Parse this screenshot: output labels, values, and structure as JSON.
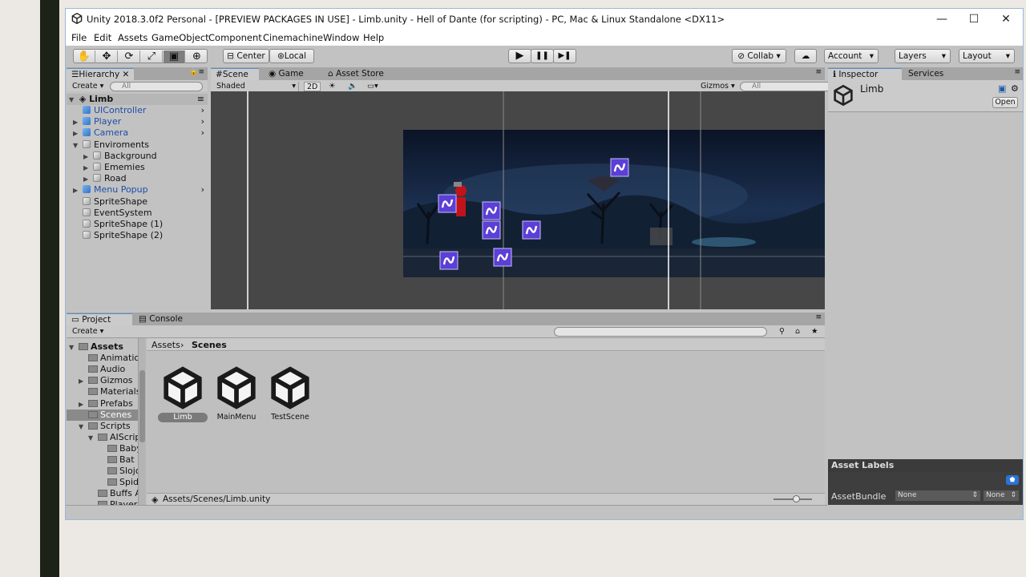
{
  "window": {
    "title": "Unity 2018.3.0f2 Personal - [PREVIEW PACKAGES IN USE] - Limb.unity - Hell of Dante (for scripting) - PC, Mac & Linux Standalone <DX11>",
    "minimize": "—",
    "maximize": "☐",
    "close": "✕"
  },
  "menu": [
    "File",
    "Edit",
    "Assets",
    "GameObject",
    "Component",
    "Cinemachine",
    "Window",
    "Help"
  ],
  "toolbar": {
    "tools": [
      "✋",
      "✥",
      "⟳",
      "⤢",
      "▣",
      "⊕"
    ],
    "pivot": "Center",
    "space": "Local",
    "play": "▶",
    "pause": "❚❚",
    "step": "▶❚",
    "collab": "Collab",
    "cloud": "☁",
    "account": "Account",
    "layers": "Layers",
    "layout": "Layout"
  },
  "hierarchy": {
    "tab": "Hierarchy",
    "create": "Create",
    "search_placeholder": "All",
    "scene": "Limb",
    "items": [
      {
        "label": "UIController",
        "prefab": true,
        "arrow": "",
        "more": true
      },
      {
        "label": "Player",
        "prefab": true,
        "arrow": "▶",
        "more": true
      },
      {
        "label": "Camera",
        "prefab": true,
        "arrow": "▶",
        "more": true
      },
      {
        "label": "Enviroments",
        "prefab": false,
        "arrow": "▼",
        "more": false
      },
      {
        "label": "Background",
        "prefab": false,
        "arrow": "▶",
        "more": false,
        "indent": 1
      },
      {
        "label": "Ememies",
        "prefab": false,
        "arrow": "▶",
        "more": false,
        "indent": 1
      },
      {
        "label": "Road",
        "prefab": false,
        "arrow": "▶",
        "more": false,
        "indent": 1
      },
      {
        "label": "Menu Popup",
        "prefab": true,
        "arrow": "▶",
        "more": true
      },
      {
        "label": "SpriteShape",
        "prefab": false,
        "arrow": "",
        "more": false
      },
      {
        "label": "EventSystem",
        "prefab": false,
        "arrow": "",
        "more": false
      },
      {
        "label": "SpriteShape (1)",
        "prefab": false,
        "arrow": "",
        "more": false
      },
      {
        "label": "SpriteShape (2)",
        "prefab": false,
        "arrow": "",
        "more": false
      }
    ]
  },
  "scene": {
    "tabs": [
      "Scene",
      "Game",
      "Asset Store"
    ],
    "shading": "Shaded",
    "mode_2d": "2D",
    "gizmos": "Gizmos",
    "search_placeholder": "All"
  },
  "project": {
    "tabs": [
      "Project",
      "Console"
    ],
    "create": "Create",
    "breadcrumb": [
      "Assets",
      "Scenes"
    ],
    "tree": [
      {
        "label": "Assets",
        "arrow": "▼",
        "indent": 0,
        "bold": true
      },
      {
        "label": "Animations",
        "arrow": "",
        "indent": 1
      },
      {
        "label": "Audio",
        "arrow": "",
        "indent": 1
      },
      {
        "label": "Gizmos",
        "arrow": "▶",
        "indent": 1
      },
      {
        "label": "Materials",
        "arrow": "",
        "indent": 1
      },
      {
        "label": "Prefabs",
        "arrow": "▶",
        "indent": 1
      },
      {
        "label": "Scenes",
        "arrow": "",
        "indent": 1,
        "selected": true
      },
      {
        "label": "Scripts",
        "arrow": "▼",
        "indent": 1
      },
      {
        "label": "AIScripts",
        "arrow": "▼",
        "indent": 2
      },
      {
        "label": "Baby",
        "arrow": "",
        "indent": 3
      },
      {
        "label": "Bat",
        "arrow": "",
        "indent": 3
      },
      {
        "label": "Slojo",
        "arrow": "",
        "indent": 3
      },
      {
        "label": "Spider",
        "arrow": "",
        "indent": 3
      },
      {
        "label": "Buffs And",
        "arrow": "",
        "indent": 2
      },
      {
        "label": "Player",
        "arrow": "",
        "indent": 2
      }
    ],
    "files": [
      "Limb",
      "MainMenu",
      "TestScene"
    ],
    "path": "Assets/Scenes/Limb.unity"
  },
  "inspector": {
    "tabs": [
      "Inspector",
      "Services"
    ],
    "object_name": "Limb",
    "open": "Open",
    "asset_labels": "Asset Labels",
    "asset_bundle": "AssetBundle",
    "bundle_value": "None",
    "variant_value": "None"
  }
}
